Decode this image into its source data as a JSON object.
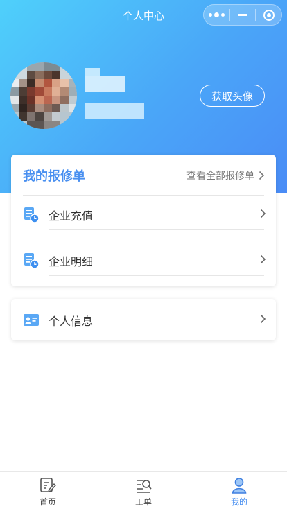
{
  "navbar": {
    "title": "个人中心"
  },
  "profile": {
    "get_avatar_label": "获取头像"
  },
  "repair_card": {
    "title": "我的报修单",
    "view_all": "查看全部报修单",
    "items": [
      {
        "label": "企业充值",
        "icon": "doc-clock-icon"
      },
      {
        "label": "企业明细",
        "icon": "doc-clock-icon"
      }
    ]
  },
  "info_card": {
    "label": "个人信息",
    "icon": "id-card-icon"
  },
  "tabs": [
    {
      "label": "首页",
      "icon": "edit-doc-icon",
      "active": false
    },
    {
      "label": "工单",
      "icon": "list-search-icon",
      "active": false
    },
    {
      "label": "我的",
      "icon": "person-icon",
      "active": true
    }
  ],
  "colors": {
    "accent": "#4a90f0",
    "header_start": "#4fd0fb",
    "header_end": "#4a8cf6"
  }
}
